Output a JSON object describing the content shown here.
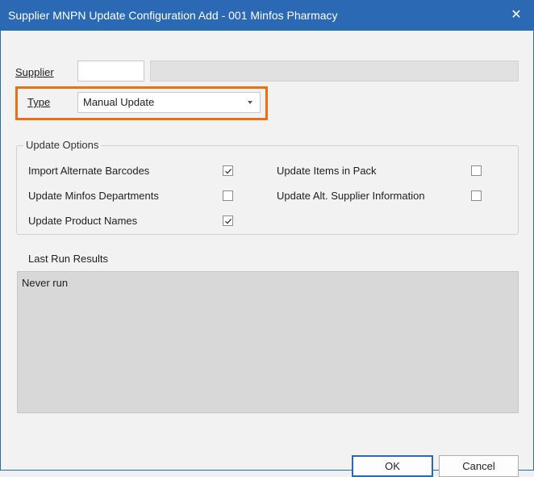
{
  "window": {
    "title": "Supplier MNPN Update Configuration Add - 001 Minfos Pharmacy",
    "close_glyph": "✕"
  },
  "supplier": {
    "label": "Supplier",
    "code_value": "",
    "name_value": ""
  },
  "type": {
    "label": "Type",
    "selected": "Manual Update"
  },
  "update_options": {
    "title": "Update Options",
    "items": [
      {
        "label": "Import Alternate Barcodes",
        "checked": true
      },
      {
        "label": "Update Minfos Departments",
        "checked": false
      },
      {
        "label": "Update Product Names",
        "checked": true
      },
      {
        "label": "Update Items in Pack",
        "checked": false
      },
      {
        "label": "Update Alt. Supplier Information",
        "checked": false
      }
    ]
  },
  "last_run": {
    "title": "Last Run Results",
    "text": "Never run"
  },
  "buttons": {
    "ok": "OK",
    "cancel": "Cancel"
  },
  "colors": {
    "title_bar": "#2b69b5",
    "highlight": "#e97014"
  },
  "icons": {
    "close": "close-icon",
    "dropdown": "chevron-down-icon",
    "check": "checkmark-icon"
  }
}
